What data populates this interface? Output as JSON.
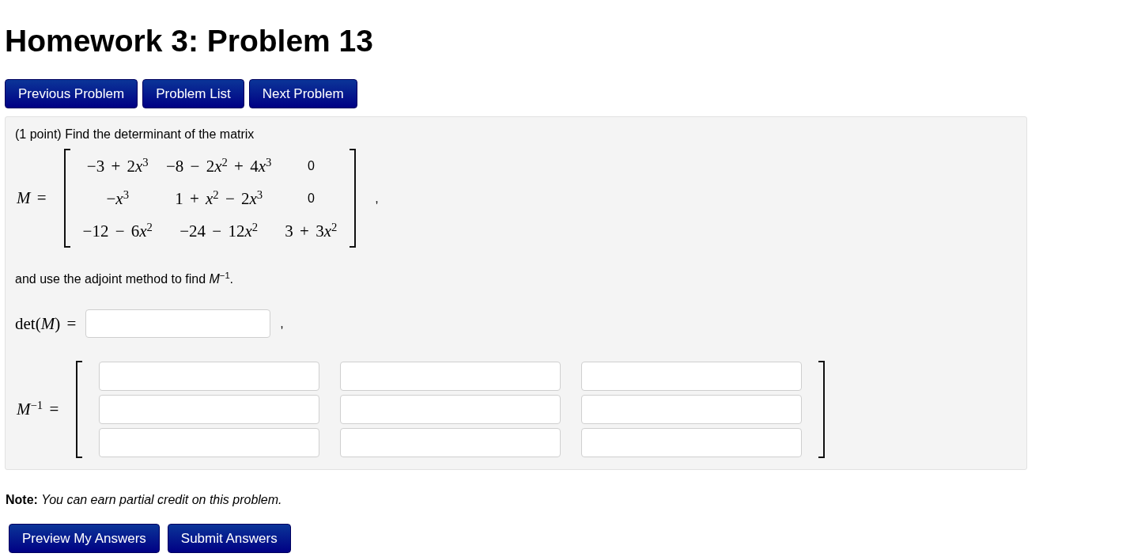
{
  "title": "Homework 3: Problem 13",
  "nav_buttons": [
    "Previous Problem",
    "Problem List",
    "Next Problem"
  ],
  "problem": {
    "intro": "(1 point) Find the determinant of the matrix",
    "matrix": {
      "label": "*M* =",
      "rows": [
        [
          {
            "kind": "math",
            "parts": [
              {
                "kind": "plain",
                "text": "−3 + 2"
              },
              {
                "kind": "var",
                "text": "x"
              },
              {
                "kind": "sup",
                "text": "3"
              }
            ]
          },
          {
            "kind": "math",
            "parts": [
              {
                "kind": "plain",
                "text": "−8 − 2"
              },
              {
                "kind": "var",
                "text": "x"
              },
              {
                "kind": "sup",
                "text": "2"
              },
              {
                "kind": "plain",
                "text": " + 4"
              },
              {
                "kind": "var",
                "text": "x"
              },
              {
                "kind": "sup",
                "text": "3"
              }
            ]
          },
          {
            "kind": "text",
            "text": "0"
          }
        ],
        [
          {
            "kind": "math",
            "parts": [
              {
                "kind": "plain",
                "text": "−"
              },
              {
                "kind": "var",
                "text": "x"
              },
              {
                "kind": "sup",
                "text": "3"
              }
            ]
          },
          {
            "kind": "math",
            "parts": [
              {
                "kind": "plain",
                "text": "1 + "
              },
              {
                "kind": "var",
                "text": "x"
              },
              {
                "kind": "sup",
                "text": "2"
              },
              {
                "kind": "plain",
                "text": " − 2"
              },
              {
                "kind": "var",
                "text": "x"
              },
              {
                "kind": "sup",
                "text": "3"
              }
            ]
          },
          {
            "kind": "text",
            "text": "0"
          }
        ],
        [
          {
            "kind": "math",
            "parts": [
              {
                "kind": "plain",
                "text": "−12 − 6"
              },
              {
                "kind": "var",
                "text": "x"
              },
              {
                "kind": "sup",
                "text": "2"
              }
            ]
          },
          {
            "kind": "math",
            "parts": [
              {
                "kind": "plain",
                "text": "−24 − 12"
              },
              {
                "kind": "var",
                "text": "x"
              },
              {
                "kind": "sup",
                "text": "2"
              }
            ]
          },
          {
            "kind": "math",
            "parts": [
              {
                "kind": "plain",
                "text": "3 + 3"
              },
              {
                "kind": "var",
                "text": "x"
              },
              {
                "kind": "sup",
                "text": "2"
              }
            ]
          }
        ]
      ],
      "trailing": ","
    },
    "instruction": "and use the adjoint method to find *M*$^{−1}$.",
    "det_answer": {
      "label": "det(*M*) =",
      "kind": "answer_field",
      "trailing": ","
    },
    "inverse_answer": {
      "label": "*M*$^{−1}$ =",
      "cells": [
        [
          {
            "kind": "answer_field"
          },
          {
            "kind": "answer_field"
          },
          {
            "kind": "answer_field"
          }
        ],
        [
          {
            "kind": "answer_field"
          },
          {
            "kind": "answer_field"
          },
          {
            "kind": "answer_field"
          }
        ],
        [
          {
            "kind": "answer_field"
          },
          {
            "kind": "answer_field"
          },
          {
            "kind": "answer_field"
          }
        ]
      ]
    }
  },
  "note": "**Note:** *You can earn partial credit on this problem.*",
  "action_buttons": [
    "Preview My Answers",
    "Submit Answers"
  ]
}
